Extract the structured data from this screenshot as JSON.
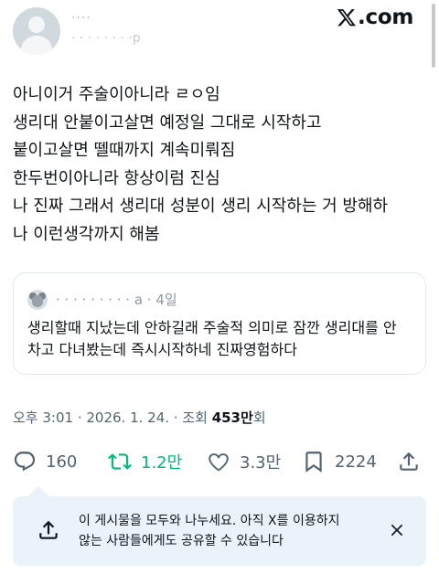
{
  "author": {
    "name": "····",
    "handle": "· · · · · · · ·p"
  },
  "brand": {
    "text": ".com"
  },
  "post": {
    "lines": [
      "아니이거 주술이아니라 ㄹㅇ임",
      "생리대 안붙이고살면 예정일 그대로 시작하고",
      "붙이고살면 뗄때까지 계속미뤄짐",
      "한두번이아니라 항상이럼 진심",
      "나 진짜 그래서 생리대 성분이 생리 시작하는 거 방해하",
      "나 이런생각까지 해봄"
    ]
  },
  "quote": {
    "meta": "·  ·   · ·   · · · · · a · 4일",
    "lines": [
      "생리할때 지났는데 안하길래 주술적 의미로 잠깐 생리대를 안",
      "차고 다녀봤는데 즉시시작하네 진짜영험하다"
    ]
  },
  "meta": {
    "time": "오후 3:01 · 2026. 1. 24. · 조회 ",
    "views": "453만",
    "views_suffix": "회"
  },
  "actions": {
    "reply": "160",
    "retweet": "1.2만",
    "like": "3.3만",
    "bookmark": "2224"
  },
  "share_prompt": {
    "line1": "이 게시물을 모두와 나누세요. 아직 X를 이용하지",
    "line2": "않는 사람들에게도 공유할 수 있습니다"
  },
  "colors": {
    "retweet": "#00ba7c",
    "muted": "#536471",
    "share_bg": "#ebf3fa"
  },
  "icons": [
    "x-logo-icon",
    "reply-icon",
    "retweet-icon",
    "like-icon",
    "bookmark-icon",
    "share-icon",
    "close-icon"
  ]
}
